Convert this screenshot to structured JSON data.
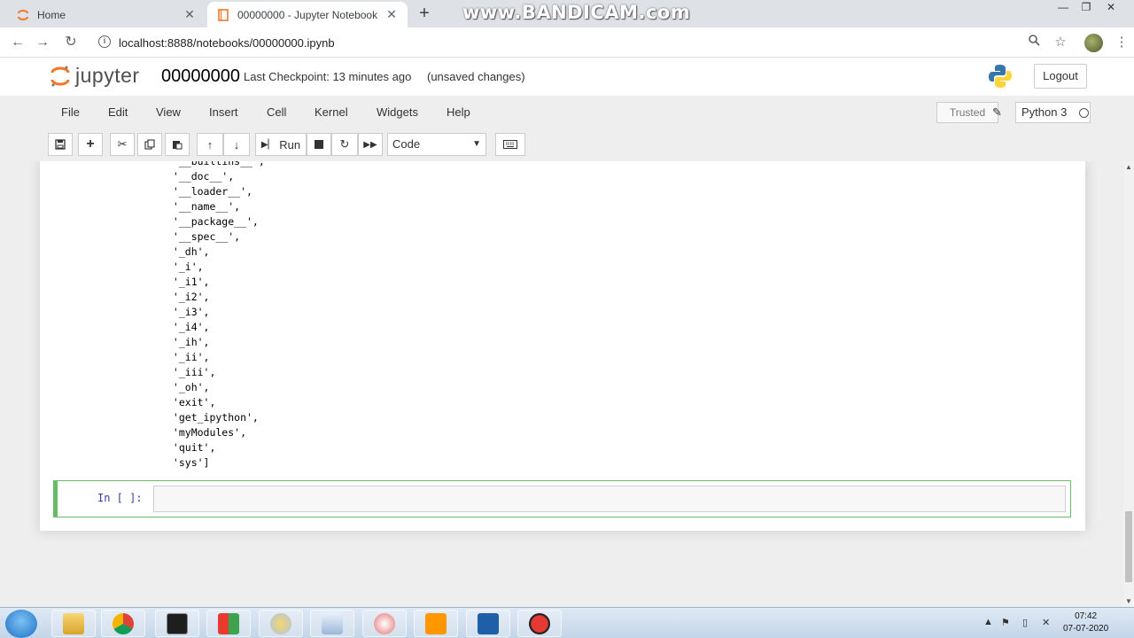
{
  "browser": {
    "tabs": [
      {
        "title": "Home",
        "active": false
      },
      {
        "title": "00000000 - Jupyter Notebook",
        "active": true
      }
    ],
    "watermark": "www.BANDICAM.com",
    "url": "localhost:8888/notebooks/00000000.ipynb"
  },
  "jupyter": {
    "logo_text": "jupyter",
    "notebook_name": "00000000",
    "checkpoint": "Last Checkpoint: 13 minutes ago",
    "unsaved": "(unsaved changes)",
    "logout": "Logout",
    "menu": [
      "File",
      "Edit",
      "View",
      "Insert",
      "Cell",
      "Kernel",
      "Widgets",
      "Help"
    ],
    "trusted": "Trusted",
    "kernel": "Python 3",
    "toolbar": {
      "run_label": "Run",
      "cell_type": "Code"
    }
  },
  "output_lines": [
    " '__builtins__',",
    " '__doc__',",
    " '__loader__',",
    " '__name__',",
    " '__package__',",
    " '__spec__',",
    " '_dh',",
    " '_i',",
    " '_i1',",
    " '_i2',",
    " '_i3',",
    " '_i4',",
    " '_ih',",
    " '_ii',",
    " '_iii',",
    " '_oh',",
    " 'exit',",
    " 'get_ipython',",
    " 'myModules',",
    " 'quit',",
    " 'sys']"
  ],
  "cell": {
    "prompt": "In [ ]:"
  },
  "taskbar": {
    "time": "07:42",
    "date": "07-07-2020"
  }
}
